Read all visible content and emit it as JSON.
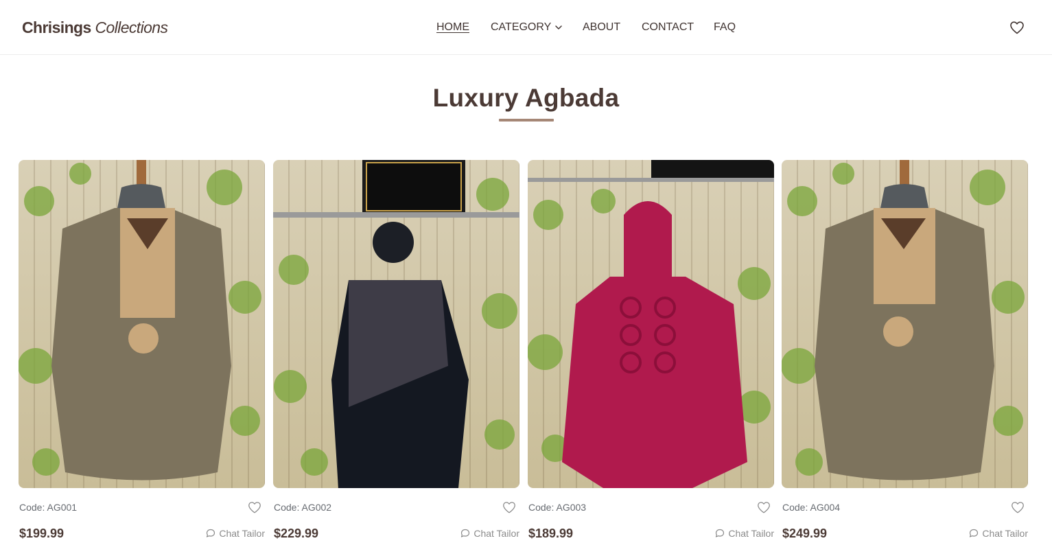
{
  "header": {
    "brand_bold": "Chrisings",
    "brand_italic": "Collections",
    "nav": {
      "home": "HOME",
      "category": "CATEGORY",
      "about": "ABOUT",
      "contact": "CONTACT",
      "faq": "FAQ"
    },
    "icons": {
      "wishlist": "heart-icon",
      "dropdown": "chevron-down-icon"
    }
  },
  "section": {
    "title": "Luxury Agbada",
    "accent_color": "#a58776"
  },
  "products": [
    {
      "code": "Code: AG001",
      "price": "$199.99",
      "chat_label": "Chat Tailor",
      "garment_color": "#7d735d",
      "accent": "#c9a87c"
    },
    {
      "code": "Code: AG002",
      "price": "$229.99",
      "chat_label": "Chat Tailor",
      "garment_color": "#141821",
      "accent": "#5a5560"
    },
    {
      "code": "Code: AG003",
      "price": "$189.99",
      "chat_label": "Chat Tailor",
      "garment_color": "#b01a4d",
      "accent": "#8c0f3a"
    },
    {
      "code": "Code: AG004",
      "price": "$249.99",
      "chat_label": "Chat Tailor",
      "garment_color": "#7d735d",
      "accent": "#c9a87c"
    }
  ]
}
